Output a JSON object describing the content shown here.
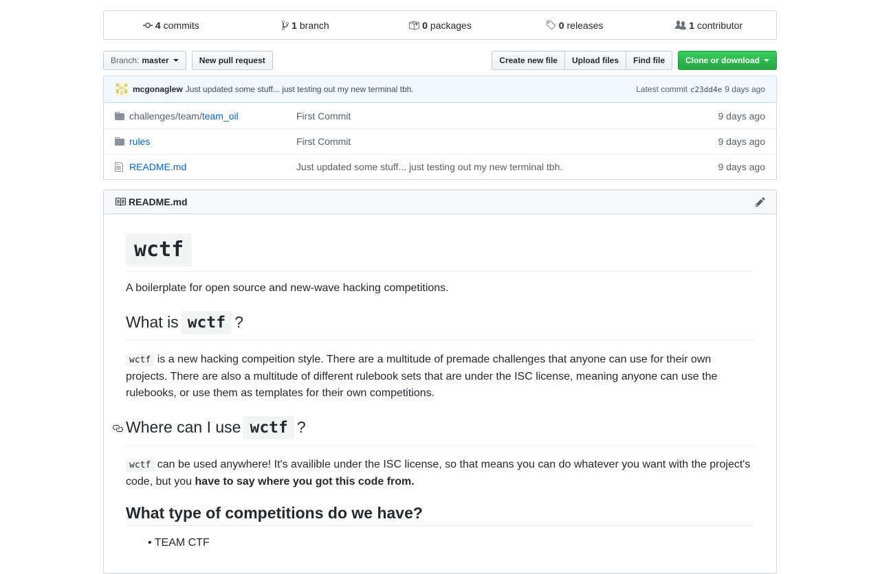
{
  "summary": {
    "commits": {
      "count": "4",
      "label": "commits"
    },
    "branch": {
      "count": "1",
      "label": "branch"
    },
    "packages": {
      "count": "0",
      "label": "packages"
    },
    "releases": {
      "count": "0",
      "label": "releases"
    },
    "contributors": {
      "count": "1",
      "label": "contributor"
    }
  },
  "toolbar": {
    "branch_prefix": "Branch:",
    "branch_name": "master",
    "new_pr": "New pull request",
    "create_file": "Create new file",
    "upload_files": "Upload files",
    "find_file": "Find file",
    "clone": "Clone or download"
  },
  "commit_tease": {
    "author": "mcgonaglew",
    "message": "Just updated some stuff... just testing out my new terminal tbh.",
    "latest_label": "Latest commit",
    "sha": "c23dd4e",
    "age": "9 days ago"
  },
  "files": [
    {
      "prefix": "challenges/team/",
      "name": "team_oil",
      "message": "First Commit",
      "age": "9 days ago",
      "icon": "folder-icon"
    },
    {
      "prefix": "",
      "name": "rules",
      "message": "First Commit",
      "age": "9 days ago",
      "icon": "folder-icon"
    },
    {
      "prefix": "",
      "name": "README.md",
      "message": "Just updated some stuff... just testing out my new terminal tbh.",
      "age": "9 days ago",
      "icon": "file-icon"
    }
  ],
  "readme": {
    "filename": "README.md",
    "title": "wctf",
    "intro": "A boilerplate for open source and new-wave hacking competitions.",
    "h2_what_pre": "What is",
    "h2_what_code": "wctf",
    "h2_what_post": "?",
    "p_what_code": "wctf",
    "p_what_text": "is a new hacking compeition style. There are a multitude of premade challenges that anyone can use for their own projects. There are also a multitude of different rulebook sets that are under the ISC license, meaning anyone can use the rulebooks, or use them as templates for their own competitions.",
    "h2_where_pre": "Where can I use",
    "h2_where_code": "wctf",
    "h2_where_post": "?",
    "p_where_code": "wctf",
    "p_where_text": "can be used anywhere! It's availible under the ISC license, so that means you can do whatever you want with the project's code, but you",
    "p_where_bold": "have to say where you got this code from.",
    "h2_types": "What type of competitions do we have?",
    "li_first": "TEAM CTF"
  }
}
